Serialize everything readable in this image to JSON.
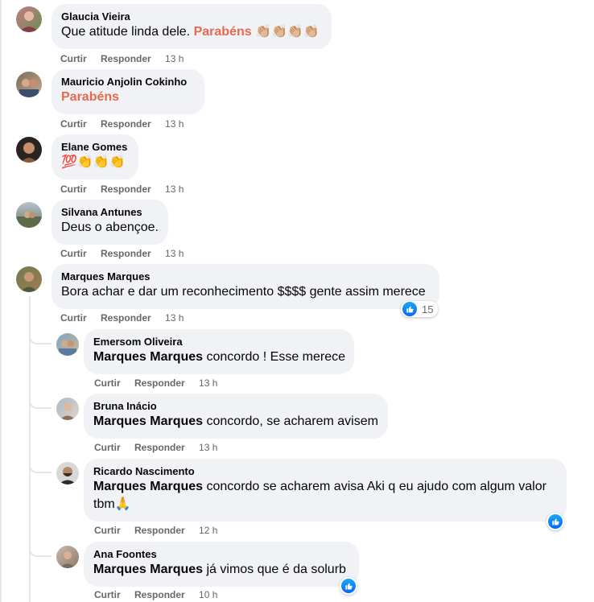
{
  "actions": {
    "like": "Curtir",
    "reply": "Responder"
  },
  "comments": [
    {
      "author": "Glaucia Vieira",
      "text": "Que atitude linda dele.",
      "highlight": "Parabéns",
      "emoji": "👏🏼👏🏼👏🏼👏🏼",
      "time": "13 h"
    },
    {
      "author": "Mauricio Anjolin Cokinho",
      "highlight": "Parabéns",
      "time": "13 h"
    },
    {
      "author": "Elane Gomes",
      "emoji": "💯👏👏👏",
      "time": "13 h"
    },
    {
      "author": "Silvana Antunes",
      "text": "Deus o abençoe.",
      "time": "13 h"
    },
    {
      "author": "Marques Marques",
      "text": "Bora achar e dar um reconhecimento $$$$ gente assim merece",
      "time": "13 h",
      "reactions": "15"
    }
  ],
  "replies": [
    {
      "author": "Emersom Oliveira",
      "mention": "Marques Marques",
      "text": "concordo ! Esse merece",
      "time": "13 h"
    },
    {
      "author": "Bruna Inácio",
      "mention": "Marques Marques",
      "text": "concordo, se acharem avisem",
      "time": "13 h"
    },
    {
      "author": "Ricardo Nascimento",
      "mention": "Marques Marques",
      "text": "concordo se acharem avisa Aki q eu ajudo com algum valor",
      "text2": "tbm",
      "emoji": "🙏",
      "time": "12 h"
    },
    {
      "author": "Ana Foontes",
      "mention": "Marques Marques",
      "text": "já vimos que é da solurb",
      "time": "10 h"
    }
  ],
  "colors": {
    "bubble": "#f0f2f5",
    "highlight": "#e8694f",
    "like_blue": "#0866ff",
    "meta": "#65676b"
  },
  "icons": [
    "like-icon",
    "avatar"
  ]
}
